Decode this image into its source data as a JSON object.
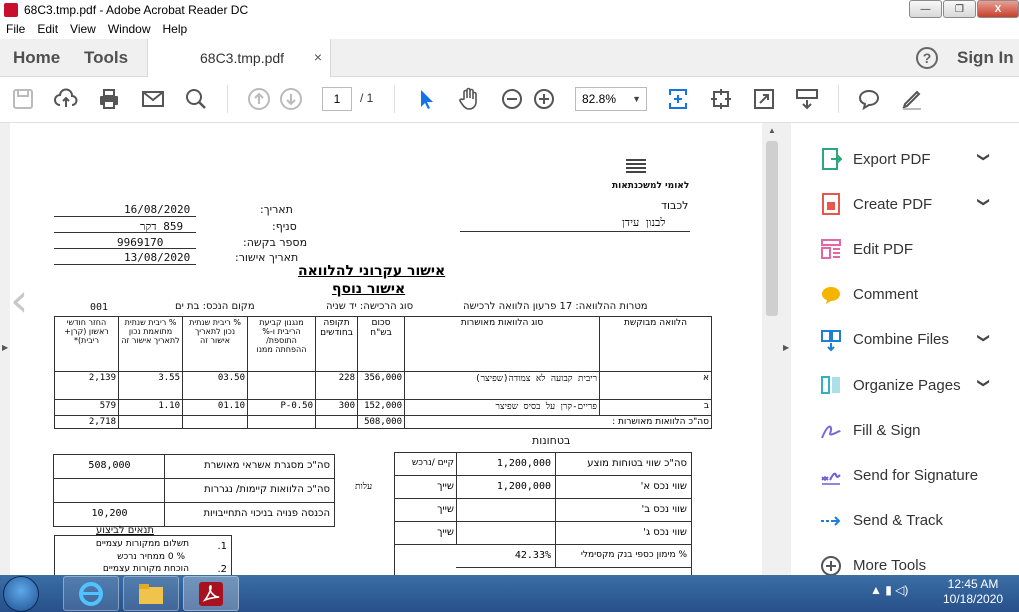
{
  "window": {
    "title": "68C3.tmp.pdf - Adobe Acrobat Reader DC",
    "min": "—",
    "max": "❐",
    "close": "X"
  },
  "menu": [
    "File",
    "Edit",
    "View",
    "Window",
    "Help"
  ],
  "tabs": {
    "home": "Home",
    "tools": "Tools",
    "doc": "68C3.tmp.pdf",
    "close": "×",
    "help": "?",
    "signin": "Sign In"
  },
  "toolbar": {
    "page_current": "1",
    "page_total": "/ 1",
    "zoom": "82.8%"
  },
  "doc": {
    "bank_name": "לאומי למשכנתאות",
    "to_label": "לכבוד",
    "to_name": "לבנון עידן",
    "date_label": "תאריך:",
    "date_value": "16/08/2020",
    "branch_label": "סניף:",
    "branch_value": "859 דקר",
    "request_label": "מספר בקשה:",
    "request_value": "9969170",
    "approval_date_label": "תאריך אישור:",
    "approval_date_value": "13/08/2020",
    "heading1": "אישור עקרוני להלוואה",
    "heading2": "אישור נוסף",
    "purpose_line": "מטרות ההלוואה: 17 פרעון הלוואה לרכישה",
    "property_type": "סוג הרכישה: יד שניה",
    "property_location": "מקום הנכס: בת ים",
    "code": "001",
    "headers": [
      "הלוואה מבוקשת",
      "סוג הלוואות מאושרות",
      "סכום בש\"ח",
      "תקופה בחודשים",
      "מנגנון קביעת הריבית ו-% התוספת/ ההפחתה ממנו",
      "% ריבית שנתית נכון לתאריך אישור זה",
      "% ריבית שנתית מתואמת נכון לתאריך אישור זה",
      "החזר חודשי ראשון (קרן+ ריבית)*"
    ],
    "rows": [
      {
        "idx": "א",
        "type": "ריבית קבועה לא צמודה(שפיצר)",
        "amount": "356,000",
        "period": "228",
        "mech": "",
        "rate": "03.50",
        "adj": "3.55",
        "payment": "2,139"
      },
      {
        "idx": "ב",
        "type": "פריים-קרן על בסיס שפיצר",
        "amount": "152,000",
        "period": "300",
        "mech": "P-0.50",
        "rate": "01.10",
        "adj": "1.10",
        "payment": "579"
      }
    ],
    "total_label": "סה\"כ הלוואות מאושרות :",
    "total_amount": "508,000",
    "total_payment": "2,718",
    "collateral_heading": "בטחונות",
    "credit_frame_label": "סה\"כ מסגרת אשראי מאושרת",
    "credit_frame_value": "508,000",
    "existing_loans_label": "סה\"כ הלוואות קיימות/ נגררות",
    "income_label": "הכנסה פנויה בניכוי התחייבויות",
    "income_value": "10,200",
    "collateral_total_label": "סה\"כ שווי בטוחות מוצע",
    "collateral_total_value": "1,200,000",
    "existing_buy": "קיים /נרכש",
    "prop_a_label": "שווי נכס א'",
    "prop_a_value": "1,200,000",
    "prop_a_type": "שייך",
    "prop_a_status": "עלות",
    "prop_b_label": "שווי נכס ב'",
    "prop_b_type": "שייך",
    "prop_c_label": "שווי נכס ג'",
    "prop_c_type": "שייך",
    "ltv_label": "% מימון כספי בנק מקסימלי",
    "ltv_value": "42.33%",
    "conditions_heading": "תנאים לביצוע",
    "cond1": "תשלום ממקורות עצמיים",
    "cond1_num": "1.",
    "cond_pct": "% 0 ממחיר נרכש",
    "cond2": "הוכחת מקורות עצמיים",
    "cond2_num": "2."
  },
  "right_panel": [
    {
      "label": "Export PDF",
      "icon": "export-pdf-icon",
      "color": "#2ea57a",
      "chevron": true
    },
    {
      "label": "Create PDF",
      "icon": "create-pdf-icon",
      "color": "#e8584a",
      "chevron": true
    },
    {
      "label": "Edit PDF",
      "icon": "edit-pdf-icon",
      "color": "#e565a6",
      "chevron": false
    },
    {
      "label": "Comment",
      "icon": "comment-icon",
      "color": "#f4b400",
      "chevron": false
    },
    {
      "label": "Combine Files",
      "icon": "combine-files-icon",
      "color": "#1f7ed6",
      "chevron": true
    },
    {
      "label": "Organize Pages",
      "icon": "organize-pages-icon",
      "color": "#2fb2c8",
      "chevron": true
    },
    {
      "label": "Fill & Sign",
      "icon": "fill-sign-icon",
      "color": "#7c6ad8",
      "chevron": false
    },
    {
      "label": "Send for Signature",
      "icon": "send-signature-icon",
      "color": "#6b5ed4",
      "chevron": false
    },
    {
      "label": "Send & Track",
      "icon": "send-track-icon",
      "color": "#1f7ed6",
      "chevron": false
    },
    {
      "label": "More Tools",
      "icon": "more-tools-icon",
      "color": "#555555",
      "chevron": false
    }
  ],
  "taskbar": {
    "time": "12:45 AM",
    "date": "10/18/2020"
  }
}
